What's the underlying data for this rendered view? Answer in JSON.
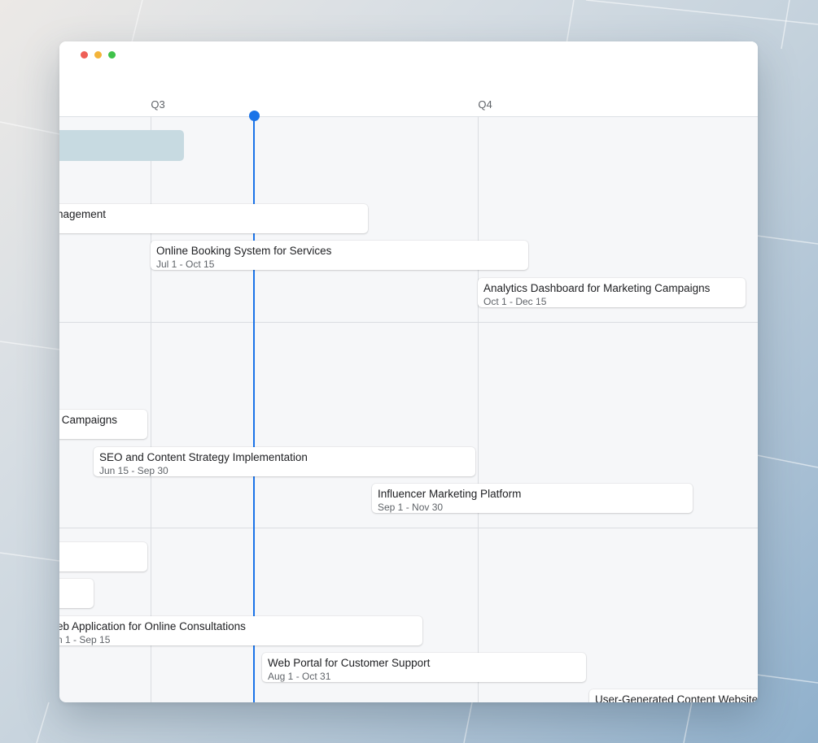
{
  "timeline": {
    "quarters": [
      {
        "label": "Q3"
      },
      {
        "label": "Q4"
      }
    ]
  },
  "tasks": [
    {
      "title": "",
      "dates": ""
    },
    {
      "title": "nagement",
      "dates": ""
    },
    {
      "title": "Online Booking System for Services",
      "dates": "Jul 1 - Oct 15"
    },
    {
      "title": "Analytics Dashboard for Marketing Campaigns",
      "dates": "Oct 1 - Dec 15"
    },
    {
      "title": "Campaigns",
      "dates": ""
    },
    {
      "title": "SEO and Content Strategy Implementation",
      "dates": "Jun 15 - Sep 30"
    },
    {
      "title": "Influencer Marketing Platform",
      "dates": "Sep 1 - Nov 30"
    },
    {
      "title": "",
      "dates": ""
    },
    {
      "title": "",
      "dates": ""
    },
    {
      "title": "eb Application for Online Consultations",
      "dates": "n 1 - Sep 15"
    },
    {
      "title": "Web Portal for Customer Support",
      "dates": "Aug 1 - Oct 31"
    },
    {
      "title": "User-Generated Content Website",
      "dates": ""
    }
  ]
}
